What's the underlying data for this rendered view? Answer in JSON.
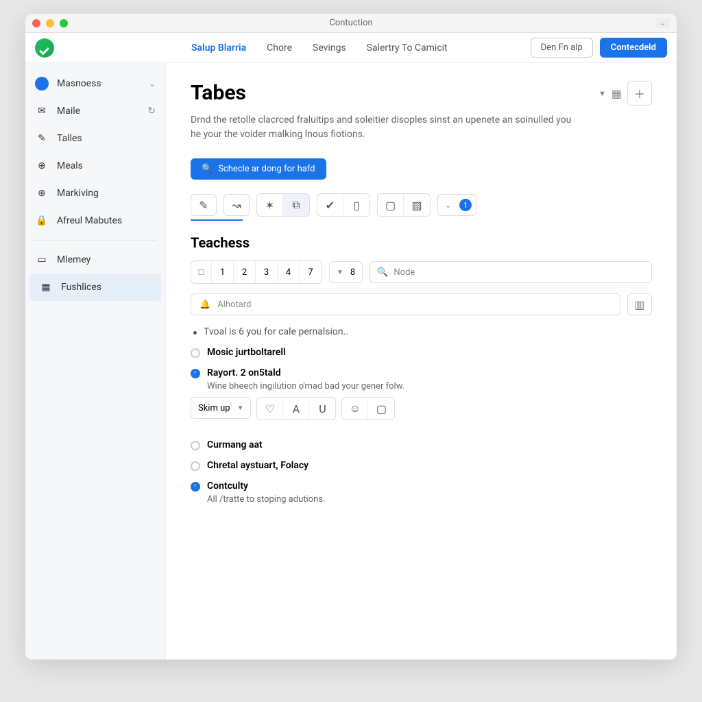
{
  "window": {
    "title": "Contuction",
    "right_badge": "⌄"
  },
  "appbar": {
    "tabs": [
      "Salup Blarria",
      "Chore",
      "Sevings",
      "Salertry To Camicit"
    ],
    "active": 0,
    "outline_btn": "Den Fn alp",
    "primary_btn": "Contecdeld"
  },
  "sidebar": {
    "user": "Masnoess",
    "items": [
      {
        "label": "Maile",
        "icon": "mail"
      },
      {
        "label": "Talles",
        "icon": "edit"
      },
      {
        "label": "Meals",
        "icon": "globe"
      },
      {
        "label": "Markiving",
        "icon": "globe"
      },
      {
        "label": "Afreul Mabutes",
        "icon": "lock"
      }
    ],
    "bottom": [
      {
        "label": "Mlemey",
        "icon": "card"
      },
      {
        "label": "Fushlices",
        "icon": "grid",
        "active": true
      }
    ]
  },
  "main": {
    "title": "Tabes",
    "desc": "Drnd the retolle clacrced fraluitips and soleitier disoples sinst an upenete an soinulled you he your the voider malking lnous fiotions.",
    "search_pill": "Schecle ar dong for hafd",
    "badge_count": "1",
    "section": "Teachess",
    "numbers": [
      "1",
      "2",
      "3",
      "4",
      "7"
    ],
    "drop_value": "8",
    "node_placeholder": "Node",
    "band_placeholder": "Alhotard",
    "first_line": "Tvoal is 6 you for cale pernalsion..",
    "items": [
      {
        "title": "Mosic jurtboltarell",
        "filled": false
      },
      {
        "title": "Rayort. 2 on5tald",
        "filled": true,
        "sub": "Wine bheech ingilution o'mad bad your gener folw.",
        "format": true
      },
      {
        "title": "Curmang aat",
        "filled": false
      },
      {
        "title": "Chretal aystuart, Folacy",
        "filled": false
      },
      {
        "title": "Contculty",
        "filled": true,
        "sub": "All /tratte to stoping adutions."
      }
    ],
    "format_label": "Skim up"
  }
}
